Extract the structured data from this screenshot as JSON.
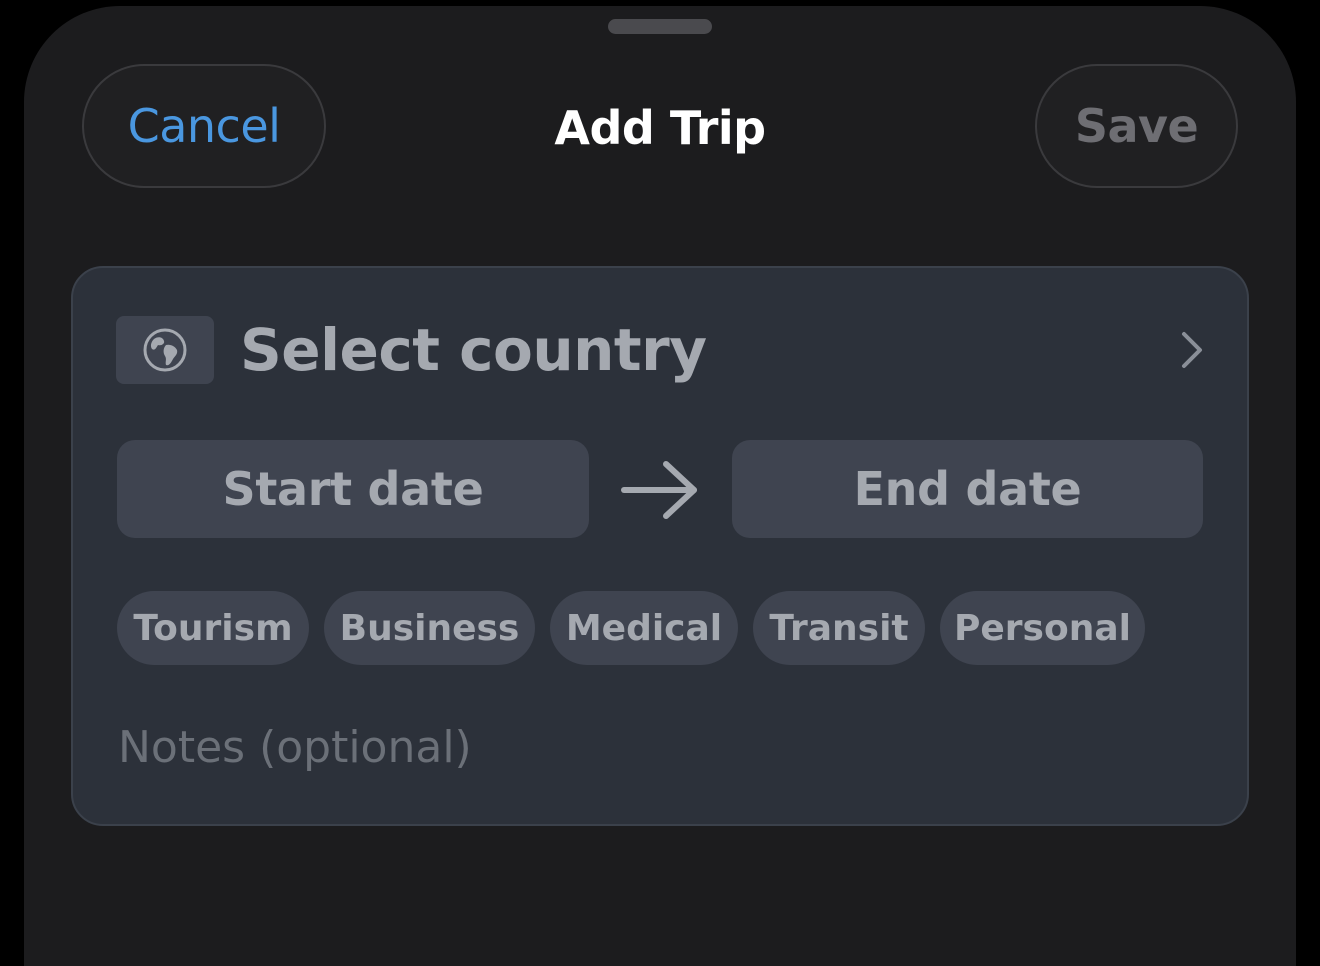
{
  "sheet": {
    "title": "Add Trip",
    "cancel_label": "Cancel",
    "save_label": "Save"
  },
  "form": {
    "country": {
      "icon": "globe-icon",
      "placeholder": "Select country",
      "disclosure_icon": "chevron-right-icon"
    },
    "dates": {
      "start_placeholder": "Start date",
      "end_placeholder": "End date",
      "separator_icon": "arrow-right-icon"
    },
    "purposes": [
      "Tourism",
      "Business",
      "Medical",
      "Transit",
      "Personal"
    ],
    "notes_placeholder": "Notes (optional)"
  },
  "colors": {
    "background": "#000000",
    "sheet": "#1c1c1e",
    "card": "#2c313a",
    "control": "#3f4450",
    "accent": "#4a97e0",
    "primary_text": "#ffffff",
    "secondary_text": "#a5a9b0",
    "disabled_text": "#6e6e73"
  }
}
